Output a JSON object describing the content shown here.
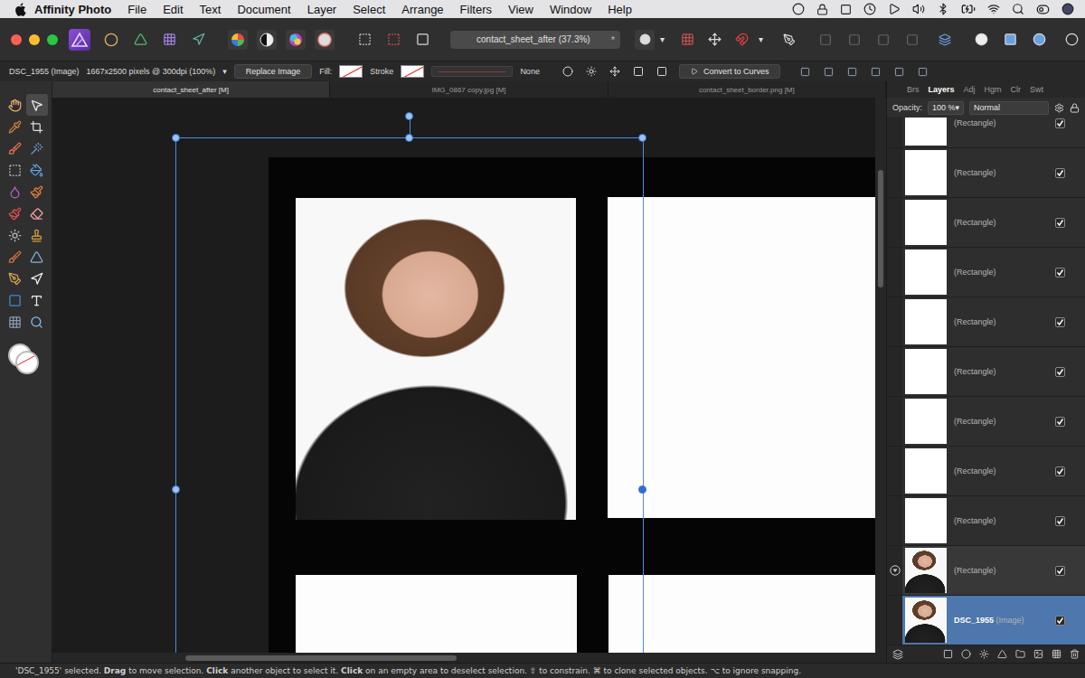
{
  "menu_bar": {
    "app": "Affinity Photo",
    "items": [
      "File",
      "Edit",
      "Text",
      "Document",
      "Layer",
      "Select",
      "Arrange",
      "Filters",
      "View",
      "Window",
      "Help"
    ]
  },
  "toolbar": {
    "document_title": "contact_sheet_after (37.3%)",
    "modified_mark": "*",
    "dropdown_mark": "▾"
  },
  "context_toolbar": {
    "layer": "DSC_1955 (Image)",
    "dimensions": "1667x2500 pixels @ 300dpi (100%)",
    "dropdown": "▾",
    "replace_button": "Replace Image",
    "fill_label": "Fill:",
    "fill_none": true,
    "stroke_label": "Stroke",
    "stroke_none": true,
    "stroke_width": "None",
    "convert_button": "Convert to Curves"
  },
  "document_tabs": [
    {
      "label": "contact_sheet_after [M]",
      "selected": true
    },
    {
      "label": "IMG_0867 copy.jpg [M]",
      "selected": false
    },
    {
      "label": "contact_sheet_border.png [M]",
      "selected": false
    }
  ],
  "panel_tabs": [
    {
      "label": "Brs",
      "selected": false
    },
    {
      "label": "Layers",
      "selected": true
    },
    {
      "label": "Adj",
      "selected": false
    },
    {
      "label": "Hgm",
      "selected": false
    },
    {
      "label": "Clr",
      "selected": false
    },
    {
      "label": "Swt",
      "selected": false
    }
  ],
  "layers_panel": {
    "opacity_label": "Opacity:",
    "opacity": "100 %",
    "opacity_dropdown": "▾",
    "blend_mode": "Normal"
  },
  "layers": [
    {
      "name": "(Rectangle)",
      "type": "",
      "kind": "rectangle",
      "visible": true,
      "selected": false,
      "expanded": false
    },
    {
      "name": "(Rectangle)",
      "type": "",
      "kind": "rectangle",
      "visible": true,
      "selected": false,
      "expanded": false
    },
    {
      "name": "(Rectangle)",
      "type": "",
      "kind": "rectangle",
      "visible": true,
      "selected": false,
      "expanded": false
    },
    {
      "name": "(Rectangle)",
      "type": "",
      "kind": "rectangle",
      "visible": true,
      "selected": false,
      "expanded": false
    },
    {
      "name": "(Rectangle)",
      "type": "",
      "kind": "rectangle",
      "visible": true,
      "selected": false,
      "expanded": false
    },
    {
      "name": "(Rectangle)",
      "type": "",
      "kind": "rectangle",
      "visible": true,
      "selected": false,
      "expanded": false
    },
    {
      "name": "(Rectangle)",
      "type": "",
      "kind": "rectangle",
      "visible": true,
      "selected": false,
      "expanded": false
    },
    {
      "name": "(Rectangle)",
      "type": "",
      "kind": "rectangle",
      "visible": true,
      "selected": false,
      "expanded": false
    },
    {
      "name": "(Rectangle)",
      "type": "",
      "kind": "rectangle",
      "visible": true,
      "selected": false,
      "expanded": false
    },
    {
      "name": "(Rectangle)",
      "type": "",
      "kind": "photo",
      "visible": true,
      "selected": false,
      "expanded": true
    },
    {
      "name": "DSC_1955",
      "type": "(Image)",
      "kind": "image",
      "visible": true,
      "selected": true,
      "expanded": false
    }
  ],
  "status_bar": [
    {
      "text": "'DSC_1955' selected. ",
      "bold": false
    },
    {
      "text": "Drag",
      "bold": true
    },
    {
      "text": " to move selection. ",
      "bold": false
    },
    {
      "text": "Click",
      "bold": true
    },
    {
      "text": " another object to select it. ",
      "bold": false
    },
    {
      "text": "Click",
      "bold": true
    },
    {
      "text": " on an empty area to deselect selection. ⇧ to constrain. ⌘ to clone selected objects. ⌥ to ignore snapping.",
      "bold": false
    }
  ]
}
